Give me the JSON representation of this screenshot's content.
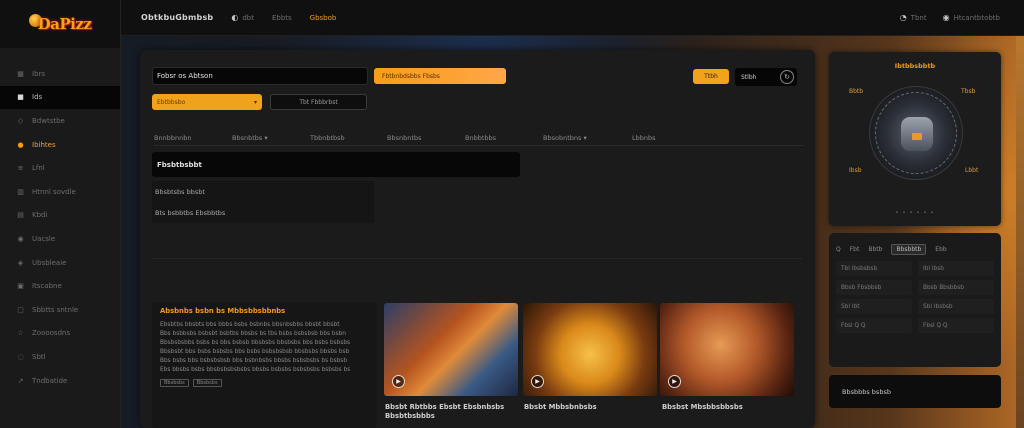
{
  "logo": {
    "text": "DaPizz"
  },
  "sidebar": {
    "items": [
      {
        "icon": "grid-icon",
        "glyph": "▦",
        "label": "Ibrs"
      },
      {
        "icon": "box-icon",
        "glyph": "■",
        "label": "Ids"
      },
      {
        "icon": "tag-icon",
        "glyph": "◇",
        "label": "Bdwtstbe"
      },
      {
        "icon": "fire-icon",
        "glyph": "●",
        "label": "Ibihtes"
      },
      {
        "icon": "list-icon",
        "glyph": "≡",
        "label": "Lfnl"
      },
      {
        "icon": "chart-icon",
        "glyph": "▥",
        "label": "Htnnl sovdle"
      },
      {
        "icon": "doc-icon",
        "glyph": "▤",
        "label": "Kbdi"
      },
      {
        "icon": "user-icon",
        "glyph": "◉",
        "label": "Uacsle"
      },
      {
        "icon": "map-icon",
        "glyph": "◈",
        "label": "Ubsbleaie"
      },
      {
        "icon": "shop-icon",
        "glyph": "▣",
        "label": "Itscabne"
      },
      {
        "icon": "bag-icon",
        "glyph": "▢",
        "label": "Sbbtts sntnle"
      },
      {
        "icon": "star-icon",
        "glyph": "☆",
        "label": "Zoooosdns"
      },
      {
        "icon": "bell-icon",
        "glyph": "◌",
        "label": "Sbtl"
      },
      {
        "icon": "send-icon",
        "glyph": "↗",
        "label": "Tndbatide"
      }
    ]
  },
  "topbar": {
    "brand": "ObtkbuGbmbsb",
    "links": [
      {
        "icon": "globe-icon",
        "glyph": "◐",
        "label": "dbt"
      },
      {
        "icon": "",
        "glyph": "",
        "label": "Ebbts"
      },
      {
        "icon": "",
        "glyph": "",
        "label": "Gbsbob"
      }
    ],
    "right": [
      {
        "icon": "user-icon",
        "glyph": "◔",
        "label": "Tbnt"
      },
      {
        "icon": "settings-icon",
        "glyph": "◉",
        "label": "Htcantbtobtb"
      }
    ]
  },
  "main": {
    "search_value": "Fobsr os Abtson",
    "orange_bar_label": "Fbtbnbdsbbs Fbsbs",
    "select_label": "Ebtbbsbo",
    "dark_button_label": "Tbt Fbbbrbst",
    "small_orange_btn": "Ttbh",
    "small_dark_btn": "Stlbh",
    "columns": [
      "Bnnbbnnbn",
      "Bbsnbtbs ▾",
      "Tbbnbtbsb",
      "Bbsnbntbs",
      "Bnbbtbbs",
      "Bbsobntbns ▾",
      "Lbbnbs"
    ],
    "section_title": "Fbsbtbsbbt",
    "info_rows": [
      "Bbsbtsbs bbsbt",
      "Bts bsbbtbs Ebsbbtbs"
    ],
    "desc_title": "Absbnbs bsbn bs Mbbsbbsbbnbs",
    "desc_lines": [
      "Ebsbtbs bbsbts bbs bbbs bsbs bsbnbs bbsnbsbbs bbsbt bbsbt",
      "Bbs bsbbsbs bsbsbt bsbtbs bbsbs bs tbs bsbs bsbsbsb bbs bsbn",
      "Bbsbsbsbbs bsbs bs bbs bsbsb bbsbsbs bbsbsbs bbs bsbs bsbsbs",
      "Bbsbsbt bbs bsbs bsbsbs bbs bsbs bsbsbsbsb bbsbsbs bbsbs bsb",
      "Bbs bsbs bbs bsbsbsbsb bbs bsbnbsbs bbsbs bsbsbsbs bs bsbsb",
      "Ebs bbsbs bsbs bbsbsbsbsbsbs bbsbs bsbsbs bsbsbsbs bsbsbs bs"
    ],
    "desc_tags": [
      "Bbsbsbs",
      "Bbsbsbs"
    ],
    "thumbs": [
      {
        "caption": "Bbsbt Rbtbbs Ebsbt Ebsbnbsbs Bbsbtbsbbbs",
        "sub": ""
      },
      {
        "caption": "Bbsbt Mbbsbnbsbs",
        "sub": ""
      },
      {
        "caption": "Bbsbst Mbsbbsbbsbs",
        "sub": ""
      }
    ]
  },
  "right": {
    "card_title": "Ibtbbsbbtb",
    "labels": [
      "Bbtb",
      "Tbsb",
      "Ibsb",
      "Lbbt"
    ],
    "footer": "• • • • • •",
    "tabs": [
      "Q",
      "Fbt",
      "Bbtb",
      "Bbsbbtb",
      "Ebb"
    ],
    "rows": [
      [
        "Tbl  Ibsbsbsb",
        "Ibl  Ibsb"
      ],
      [
        "Bbsb  Fbsbbsb",
        "Bbsb  Bbsbbsb"
      ],
      [
        "Sbl  Ibt",
        "Sbl  Ibsbsb"
      ],
      [
        "Fbsl  Q  Q",
        "Fbsl  Q  Q"
      ]
    ],
    "bottom_label": "Bbsbbbs bsbsb"
  },
  "colors": {
    "accent": "#f19a22",
    "panel": "#1b1b1b",
    "background": "#141414"
  }
}
